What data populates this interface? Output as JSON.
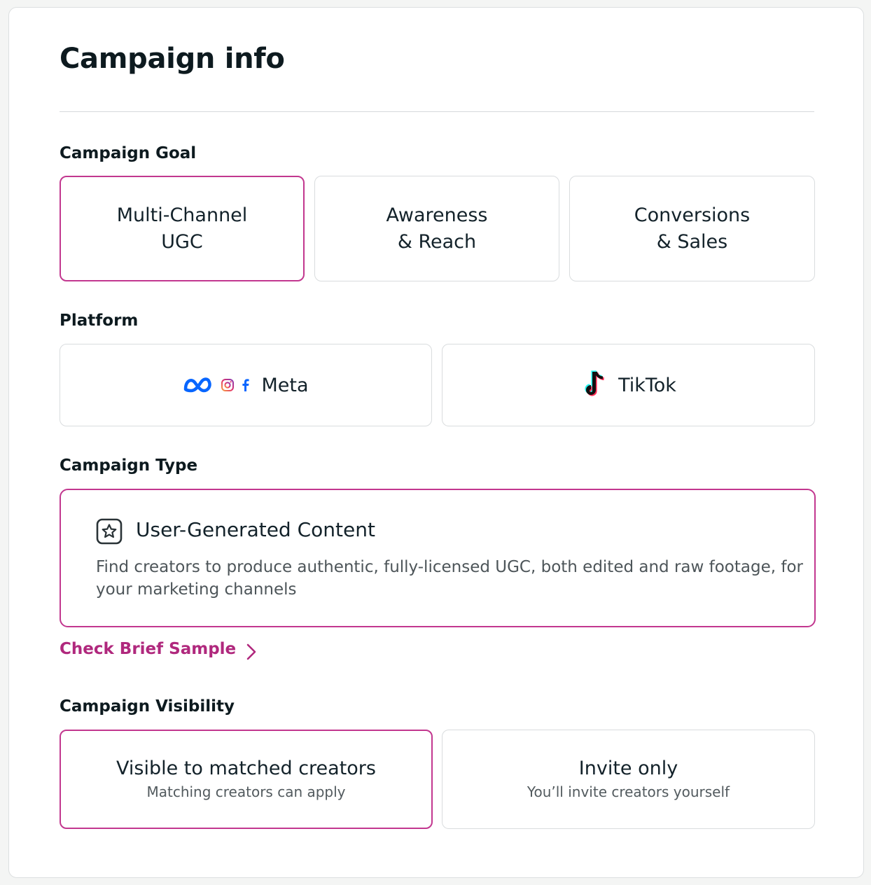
{
  "page": {
    "title": "Campaign info"
  },
  "goal": {
    "label": "Campaign Goal",
    "options": [
      {
        "label": "Multi-Channel\nUGC",
        "selected": true
      },
      {
        "label": "Awareness\n& Reach",
        "selected": false
      },
      {
        "label": "Conversions\n& Sales",
        "selected": false
      }
    ]
  },
  "platform": {
    "label": "Platform",
    "options": [
      {
        "label": "Meta",
        "icons": [
          "meta-logo-icon",
          "instagram-icon",
          "facebook-icon"
        ]
      },
      {
        "label": "TikTok",
        "icons": [
          "tiktok-icon"
        ]
      }
    ]
  },
  "type": {
    "label": "Campaign Type",
    "card": {
      "title": "User-Generated Content",
      "description": "Find creators to produce authentic, fully-licensed UGC, both edited and raw footage, for your marketing channels",
      "icon": "star-box-icon"
    },
    "brief_link": "Check Brief Sample"
  },
  "visibility": {
    "label": "Campaign Visibility",
    "options": [
      {
        "title": "Visible to matched creators",
        "subtitle": "Matching creators can apply",
        "selected": true
      },
      {
        "title": "Invite only",
        "subtitle": "You’ll invite creators yourself",
        "selected": false
      }
    ]
  },
  "colors": {
    "accent": "#c2378f",
    "link": "#b0287d",
    "meta_blue": "#0866ff"
  }
}
